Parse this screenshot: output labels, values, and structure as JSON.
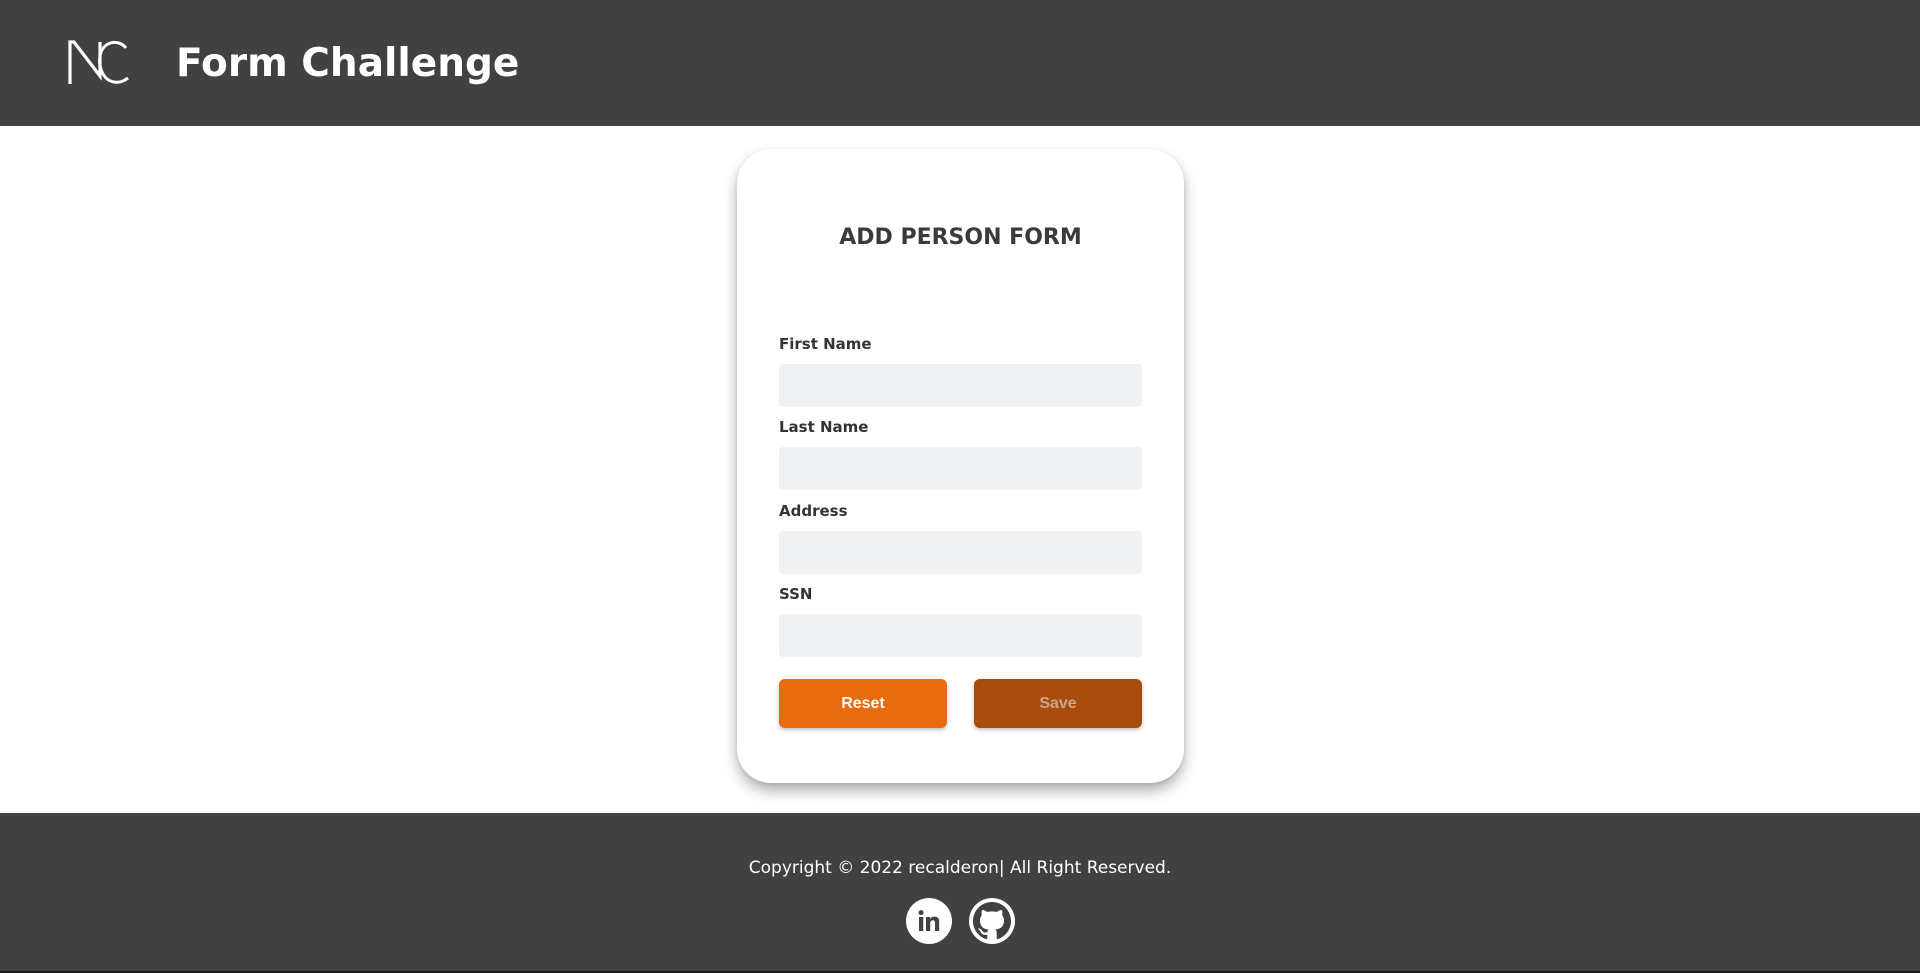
{
  "header": {
    "logo_text": "NC",
    "title": "Form Challenge"
  },
  "form": {
    "title": "ADD PERSON FORM",
    "fields": [
      {
        "label": "First Name",
        "value": "",
        "placeholder": ""
      },
      {
        "label": "Last Name",
        "value": "",
        "placeholder": ""
      },
      {
        "label": "Address",
        "value": "",
        "placeholder": ""
      },
      {
        "label": "SSN",
        "value": "",
        "placeholder": ""
      }
    ],
    "reset_label": "Reset",
    "save_label": "Save"
  },
  "footer": {
    "copyright": "Copyright © 2022 recalderon| All Right Reserved.",
    "social": [
      {
        "icon": "linkedin-icon"
      },
      {
        "icon": "github-icon"
      }
    ]
  },
  "colors": {
    "header_bg": "#414141",
    "footer_bg": "#414141",
    "reset_button": "#e96b10",
    "save_button": "#a84c0c",
    "input_bg": "#f0f1f2"
  }
}
